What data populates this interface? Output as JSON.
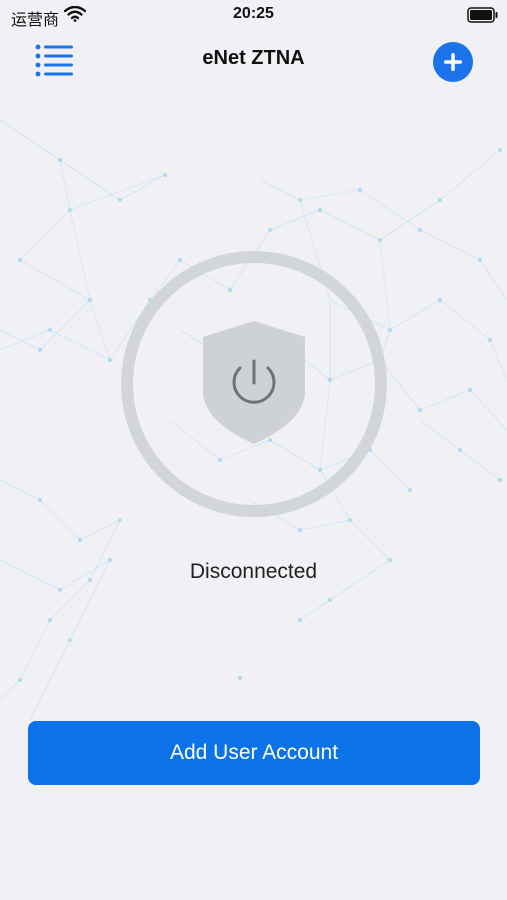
{
  "status_bar": {
    "carrier": "运营商",
    "time": "20:25"
  },
  "nav": {
    "title": "eNet ZTNA",
    "menu_icon": "list-icon",
    "add_icon": "plus-icon"
  },
  "connection": {
    "status": "Disconnected",
    "icon": "shield-power-icon"
  },
  "primary_button": {
    "label": "Add User Account"
  },
  "colors": {
    "accent": "#0b72e7",
    "background": "#f1f1f5",
    "ring": "#d3d6d8",
    "shield": "#cfd2d4"
  }
}
